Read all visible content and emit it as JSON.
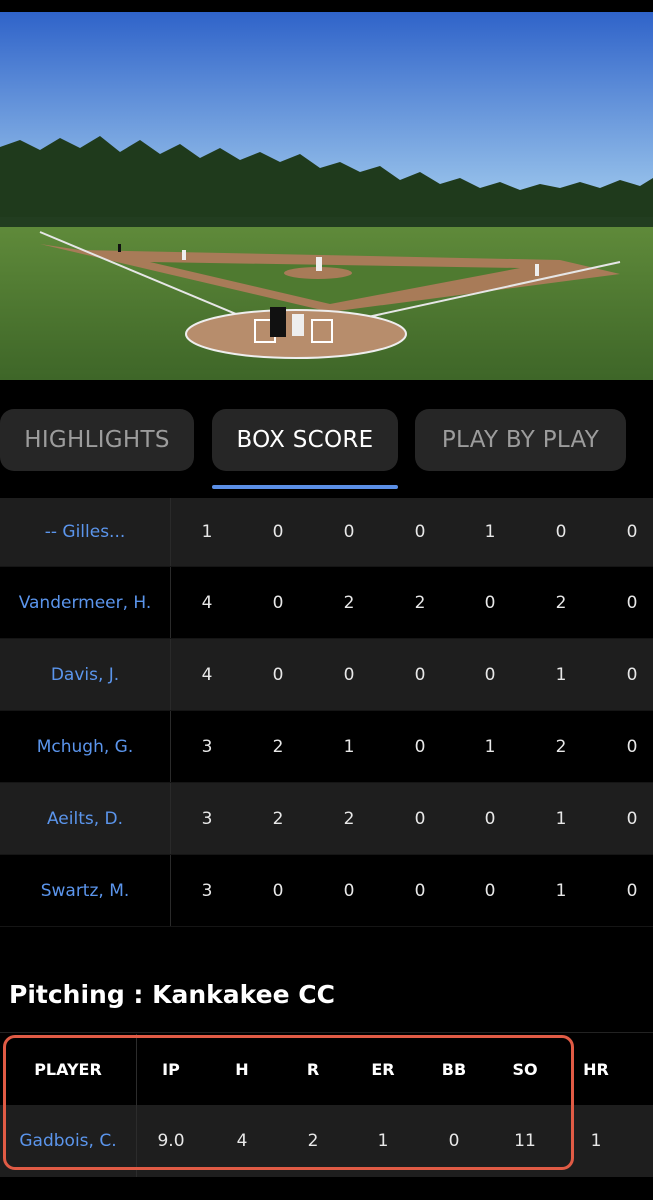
{
  "tabs": [
    {
      "label": "HIGHLIGHTS"
    },
    {
      "label": "BOX SCORE"
    },
    {
      "label": "PLAY BY PLAY"
    }
  ],
  "batting_rows": [
    {
      "name": "-- Gilles...",
      "values": [
        "1",
        "0",
        "0",
        "0",
        "1",
        "0",
        "0"
      ]
    },
    {
      "name": "Vandermeer, H.",
      "values": [
        "4",
        "0",
        "2",
        "2",
        "0",
        "2",
        "0"
      ]
    },
    {
      "name": "Davis, J.",
      "values": [
        "4",
        "0",
        "0",
        "0",
        "0",
        "1",
        "0"
      ]
    },
    {
      "name": "Mchugh, G.",
      "values": [
        "3",
        "2",
        "1",
        "0",
        "1",
        "2",
        "0"
      ]
    },
    {
      "name": "Aeilts, D.",
      "values": [
        "3",
        "2",
        "2",
        "0",
        "0",
        "1",
        "0"
      ]
    },
    {
      "name": "Swartz, M.",
      "values": [
        "3",
        "0",
        "0",
        "0",
        "0",
        "1",
        "0"
      ]
    }
  ],
  "pitching": {
    "title": "Pitching : Kankakee CC",
    "headers": [
      "PLAYER",
      "IP",
      "H",
      "R",
      "ER",
      "BB",
      "SO",
      "HR"
    ],
    "rows": [
      {
        "name": "Gadbois, C.",
        "values": [
          "9.0",
          "4",
          "2",
          "1",
          "0",
          "11",
          "1"
        ]
      }
    ]
  },
  "colors": {
    "accent": "#5b8fe6",
    "player_link": "#5b95ec",
    "highlight_border": "#e05b45"
  }
}
